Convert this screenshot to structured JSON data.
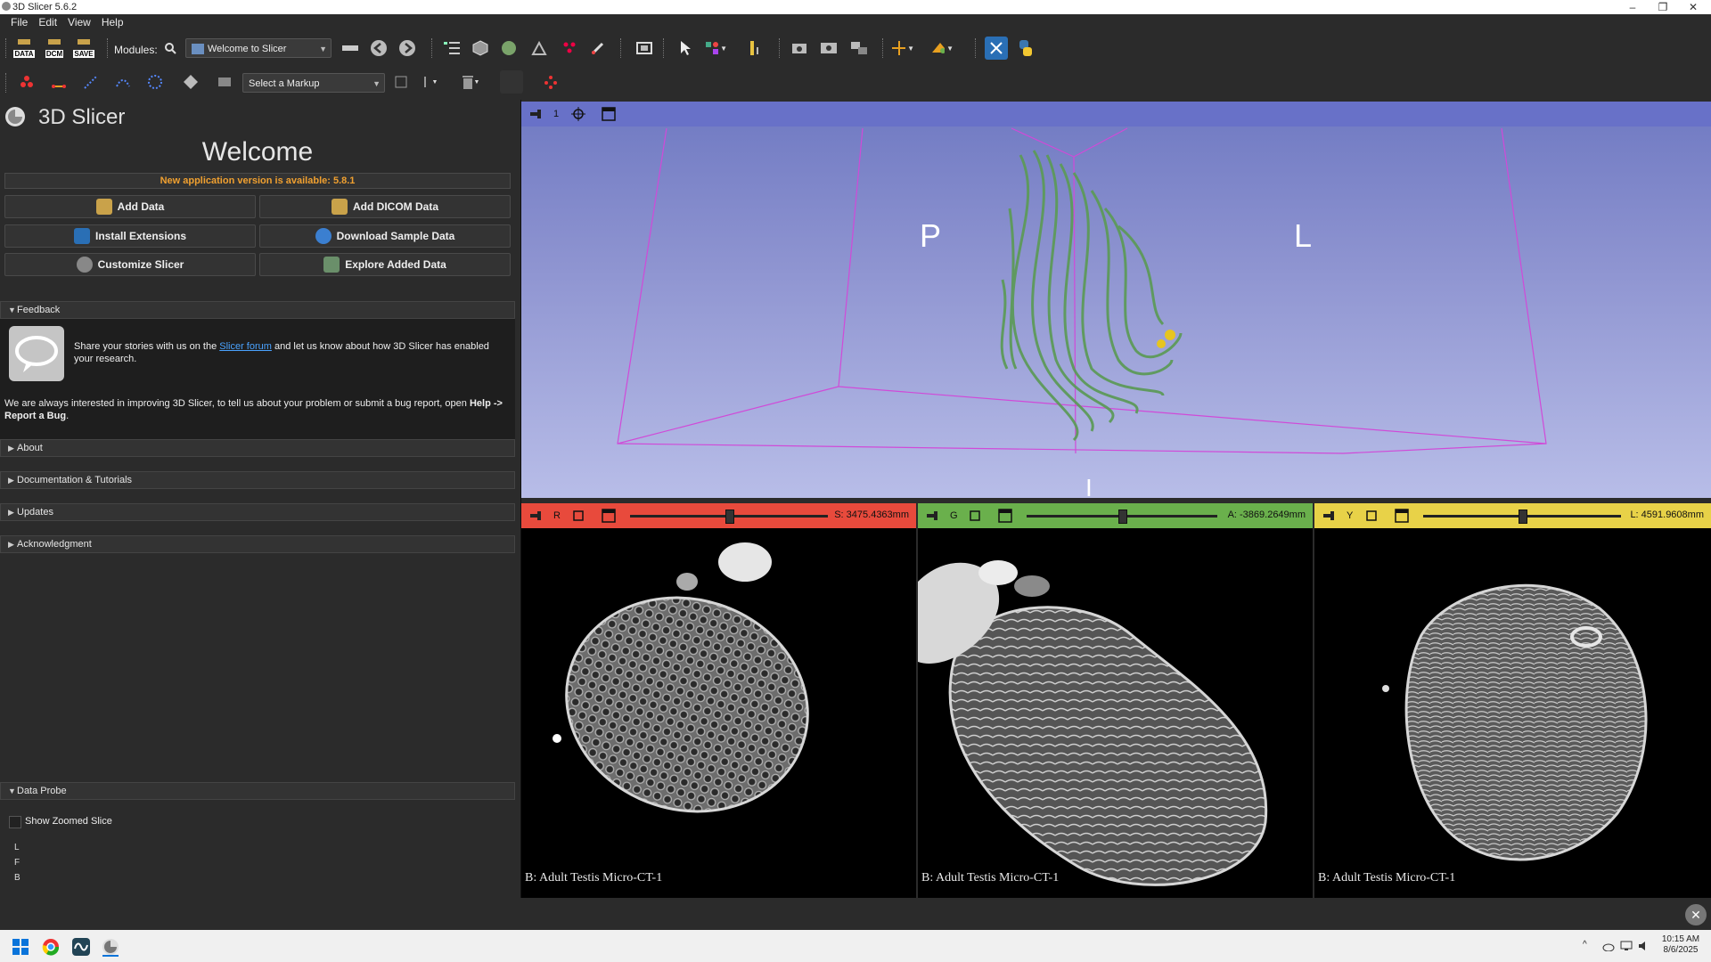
{
  "window": {
    "title": "3D Slicer 5.6.2"
  },
  "menu": {
    "items": [
      "File",
      "Edit",
      "View",
      "Help"
    ]
  },
  "toolbar": {
    "data_label": "DATA",
    "dcm_label": "DCM",
    "save_label": "SAVE",
    "modules_label": "Modules:",
    "module_selected": "Welcome to Slicer",
    "markup_selected": "Select a Markup"
  },
  "welcome": {
    "app_name": "3D Slicer",
    "heading": "Welcome",
    "update_notice": "New application version is available: 5.8.1",
    "buttons": {
      "add_data": "Add Data",
      "add_dicom": "Add DICOM Data",
      "install_extensions": "Install Extensions",
      "download_sample": "Download Sample Data",
      "customize": "Customize Slicer",
      "explore": "Explore Added Data"
    }
  },
  "feedback": {
    "section_title": "Feedback",
    "text_before_link": "Share your stories with us on the ",
    "link_text": "Slicer forum",
    "text_after_link": " and let us know about how 3D Slicer has enabled your research.",
    "bug_text": "We are always interested in improving 3D Slicer, to tell us about your problem or submit a bug report, open ",
    "bug_bold": "Help -> Report a Bug",
    "bug_end": "."
  },
  "sections": {
    "about": "About",
    "docs": "Documentation & Tutorials",
    "updates": "Updates",
    "acknowledgment": "Acknowledgment",
    "data_probe": "Data Probe"
  },
  "data_probe": {
    "show_zoomed_label": "Show Zoomed Slice",
    "show_zoomed_checked": false,
    "rows": [
      "L",
      "F",
      "B"
    ]
  },
  "view3d": {
    "number": "1",
    "orientation_left": "P",
    "orientation_right": "L",
    "orientation_bottom": "I"
  },
  "slices": {
    "red": {
      "name": "R",
      "offset": "S: 3475.4363mm",
      "color": "#e84a3c",
      "slider_pos": 0.5,
      "volume_label": "B: Adult Testis Micro-CT-1"
    },
    "green": {
      "name": "G",
      "offset": "A: -3869.2649mm",
      "color": "#6ab04c",
      "slider_pos": 0.5,
      "volume_label": "B: Adult Testis Micro-CT-1"
    },
    "yellow": {
      "name": "Y",
      "offset": "L: 4591.9608mm",
      "color": "#e8d248",
      "slider_pos": 0.5,
      "volume_label": "B: Adult Testis Micro-CT-1"
    }
  },
  "taskbar": {
    "time": "10:15 AM",
    "date": "8/6/2025"
  }
}
